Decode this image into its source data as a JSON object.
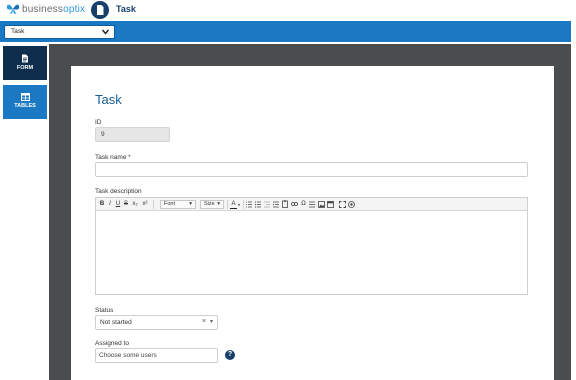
{
  "header": {
    "brand_prefix": "business",
    "brand_suffix": "optix",
    "title": "Task",
    "brand_color": "#2f9ad6",
    "dark_color": "#16406a"
  },
  "toolbar": {
    "form_selector_value": "Task",
    "bar_color": "#1b79c4"
  },
  "sidebar": {
    "items": [
      {
        "label": "FORM",
        "icon": "document-icon",
        "active": true
      },
      {
        "label": "TABLES",
        "icon": "table-icon",
        "active": false
      }
    ]
  },
  "form": {
    "title": "Task",
    "id_label": "ID",
    "id_value": "9",
    "task_name_label": "Task name *",
    "task_name_value": "",
    "description_label": "Task description",
    "editor": {
      "bold": "B",
      "italic": "I",
      "underline": "U",
      "strike": "S",
      "subscript": "x₂",
      "superscript": "x²",
      "font_label": "Font",
      "size_label": "Size",
      "text_color": "A"
    },
    "status_label": "Status",
    "status_value": "Not started",
    "assigned_label": "Assigned to",
    "assigned_placeholder": "Choose some users",
    "help_symbol": "?"
  }
}
